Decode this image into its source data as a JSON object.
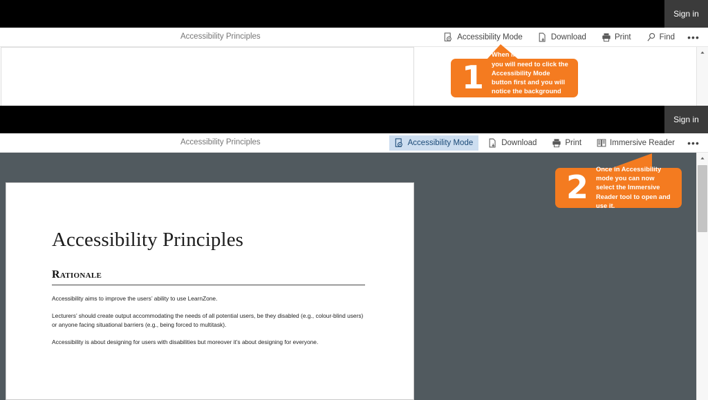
{
  "window": {
    "signin_label": "Sign in"
  },
  "document": {
    "tab_title": "Accessibility Principles",
    "heading": "Accessibility Principles",
    "subheading": "Rationale",
    "paragraphs": [
      "Accessibility aims to improve the users’ ability to use LearnZone.",
      "Lecturers’ should create output accommodating the needs of all potential users, be they disabled (e.g., colour-blind users) or anyone facing situational barriers (e.g., being forced to multitask).",
      "Accessibility is about designing for users with disabilities but moreover it’s about designing for everyone."
    ]
  },
  "toolbar_readonly": {
    "title": "Accessibility Principles",
    "items": [
      {
        "label": "Accessibility Mode",
        "icon": "accessibility-mode-icon",
        "active": false
      },
      {
        "label": "Download",
        "icon": "download-icon",
        "active": false
      },
      {
        "label": "Print",
        "icon": "print-icon",
        "active": false
      },
      {
        "label": "Find",
        "icon": "search-icon",
        "active": false
      }
    ],
    "overflow_label": "•••"
  },
  "toolbar_accessibility": {
    "title": "Accessibility Principles",
    "items": [
      {
        "label": "Accessibility Mode",
        "icon": "accessibility-mode-icon",
        "active": true
      },
      {
        "label": "Download",
        "icon": "download-icon",
        "active": false
      },
      {
        "label": "Print",
        "icon": "print-icon",
        "active": false
      },
      {
        "label": "Immersive Reader",
        "icon": "immersive-reader-icon",
        "active": false
      }
    ],
    "overflow_label": "•••"
  },
  "callouts": [
    {
      "number": "1",
      "text": "When in read-only mode you will need to click the Accessibility Mode button first and you will notice the background will darken."
    },
    {
      "number": "2",
      "text": "Once in Accessibility mode you can now select the Immersive Reader tool to open and use it."
    }
  ],
  "colors": {
    "callout_orange": "#f47b20",
    "header_black": "#000000",
    "signin_gray": "#3b3b3b",
    "darkened_background": "#515a5f",
    "active_button_blue": "#cddef0"
  }
}
